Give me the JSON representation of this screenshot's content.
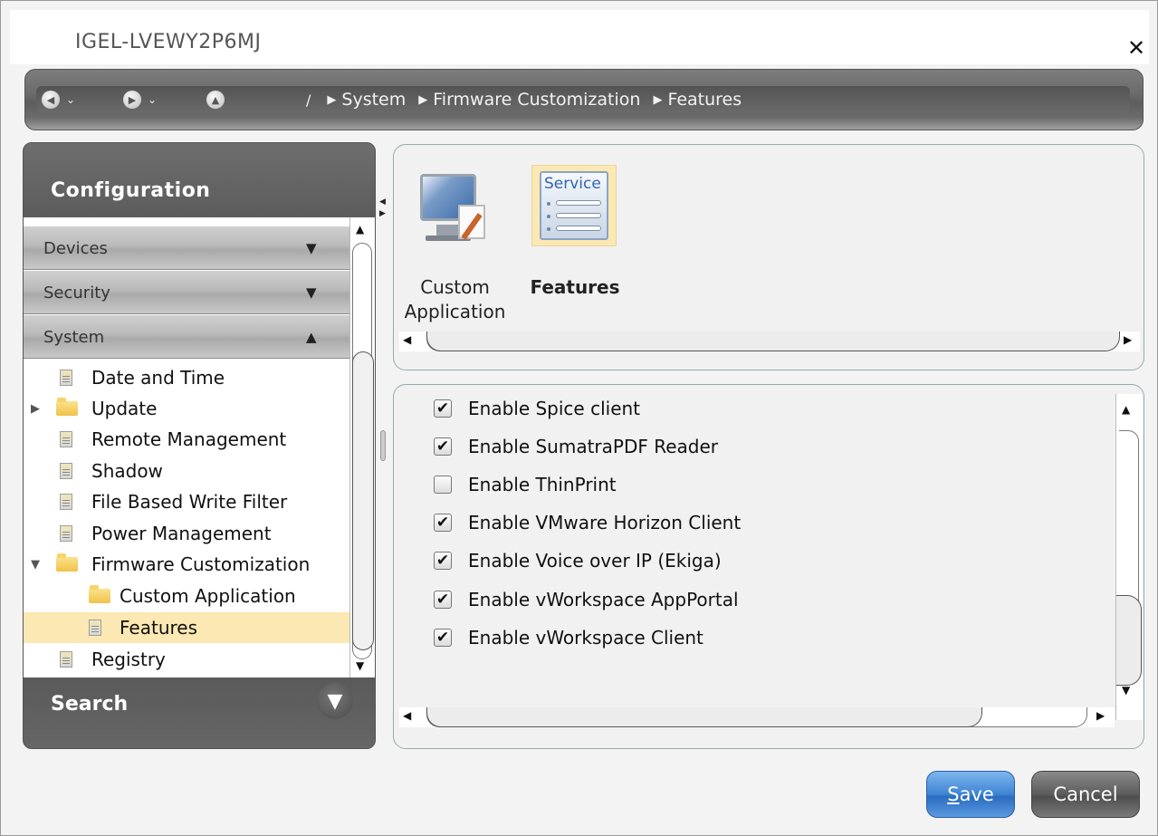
{
  "window": {
    "title": "IGEL-LVEWY2P6MJ",
    "close_glyph": "✕"
  },
  "navbar": {
    "back_icon": "back-arrow-icon",
    "forward_icon": "forward-arrow-icon",
    "up_icon": "up-arrow-icon",
    "root": "/",
    "breadcrumbs": [
      "System",
      "Firmware Customization",
      "Features"
    ]
  },
  "sidebar": {
    "header": "Configuration",
    "sections": [
      {
        "label": "Devices",
        "expanded": false
      },
      {
        "label": "Security",
        "expanded": false
      },
      {
        "label": "System",
        "expanded": true
      }
    ],
    "tree": [
      {
        "label": "Date and Time",
        "type": "page",
        "level": 0
      },
      {
        "label": "Update",
        "type": "folder",
        "level": 0,
        "expander": "collapsed"
      },
      {
        "label": "Remote Management",
        "type": "page",
        "level": 0
      },
      {
        "label": "Shadow",
        "type": "page",
        "level": 0
      },
      {
        "label": "File Based Write Filter",
        "type": "page",
        "level": 0
      },
      {
        "label": "Power Management",
        "type": "page",
        "level": 0
      },
      {
        "label": "Firmware Customization",
        "type": "folder",
        "level": 0,
        "expander": "expanded"
      },
      {
        "label": "Custom Application",
        "type": "folder",
        "level": 1
      },
      {
        "label": "Features",
        "type": "page",
        "level": 1,
        "selected": true
      },
      {
        "label": "Registry",
        "type": "page",
        "level": 0
      }
    ],
    "search_label": "Search"
  },
  "icon_panel": {
    "items": [
      {
        "label_line1": "Custom",
        "label_line2": "Application",
        "icon": "custom-application-icon"
      },
      {
        "label_line1": "Features",
        "icon": "service-features-icon",
        "selected": true,
        "icon_text": "Service"
      }
    ]
  },
  "features": [
    {
      "label": "Enable Spice client",
      "checked": true
    },
    {
      "label": "Enable SumatraPDF Reader",
      "checked": true
    },
    {
      "label": "Enable ThinPrint",
      "checked": false
    },
    {
      "label": "Enable VMware Horizon Client",
      "checked": true
    },
    {
      "label": "Enable Voice over IP (Ekiga)",
      "checked": true
    },
    {
      "label": "Enable vWorkspace AppPortal",
      "checked": true
    },
    {
      "label": "Enable vWorkspace Client",
      "checked": true
    }
  ],
  "buttons": {
    "save": "Save",
    "cancel": "Cancel"
  },
  "colors": {
    "selection": "#fce8b2",
    "save_accent": "#3f84d4",
    "nav_dark": "#5e5e5e"
  }
}
